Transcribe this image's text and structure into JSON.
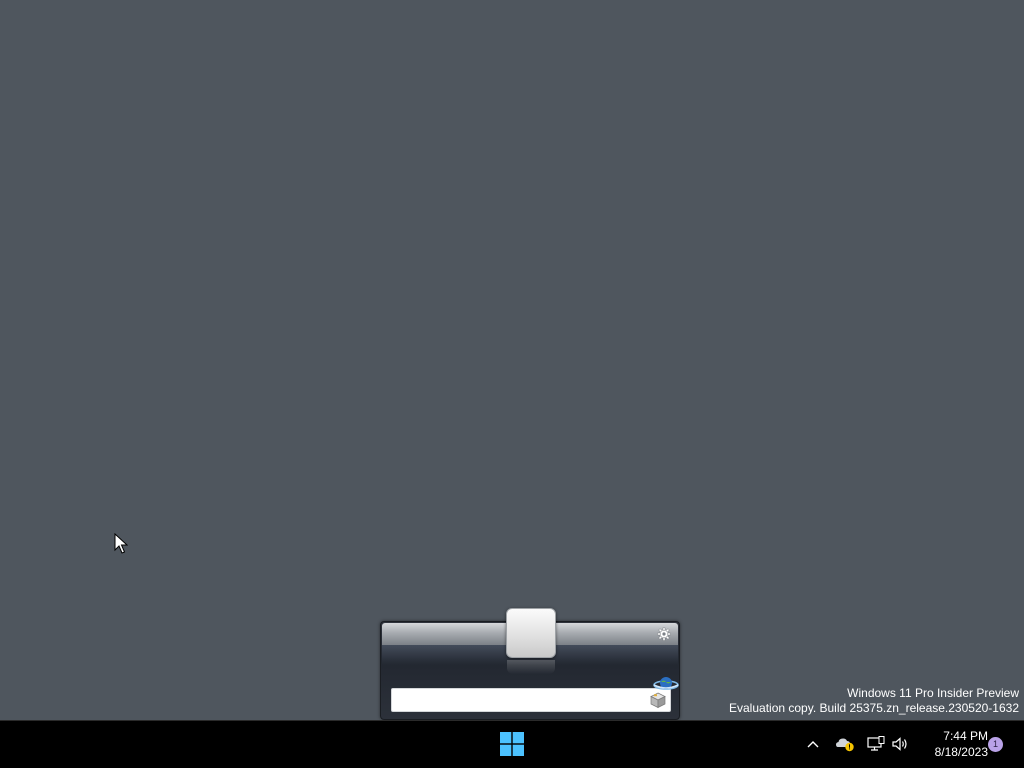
{
  "launcher": {
    "search_value": "",
    "search_placeholder": "",
    "settings_icon": "gear-icon",
    "globe_icon": "globe-icon",
    "package_icon": "package-icon"
  },
  "watermark": {
    "line1": "Windows 11 Pro Insider Preview",
    "line2": "Evaluation copy. Build 25375.zn_release.230520-1632"
  },
  "taskbar": {
    "start_icon": "windows-logo-icon",
    "tray_icons": [
      "chevron-up-icon",
      "onedrive-warning-icon",
      "network-icon",
      "volume-icon"
    ],
    "clock": {
      "time": "7:44 PM",
      "date": "8/18/2023"
    },
    "notification_count": "1"
  },
  "colors": {
    "desktop_background": "#4f565e",
    "taskbar_background": "#000000",
    "start_logo": "#4cc2ff",
    "notification_badge": "#b9a2e8",
    "warning": "#f5c400"
  }
}
